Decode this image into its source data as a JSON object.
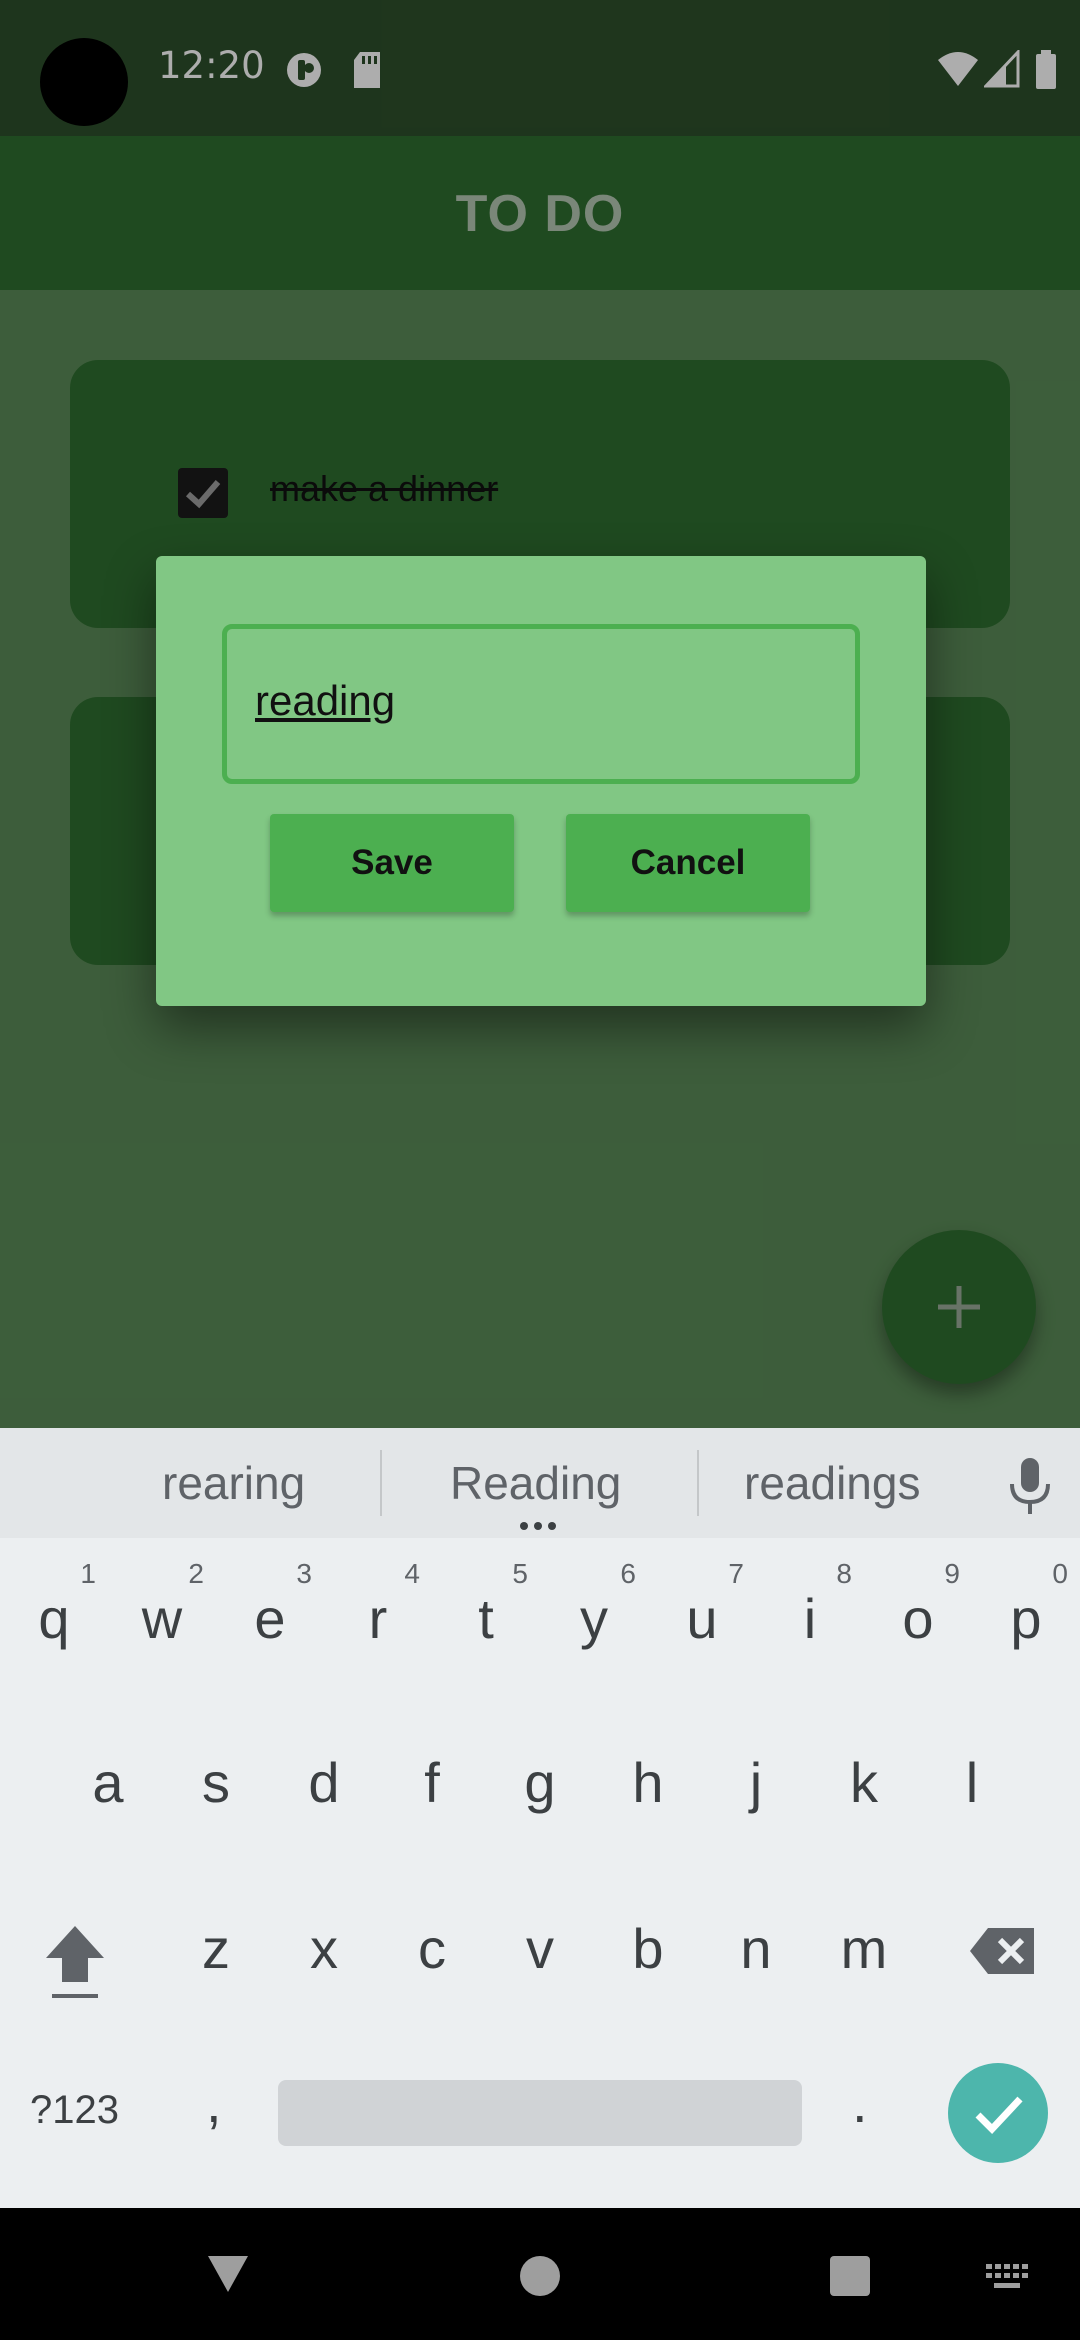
{
  "status_bar": {
    "time": "12:20"
  },
  "toolbar": {
    "title": "TO DO"
  },
  "tasks": [
    {
      "text": "make a dinner",
      "checked": true
    },
    {
      "text": "",
      "checked": false
    }
  ],
  "dialog": {
    "input_value": "reading",
    "save_label": "Save",
    "cancel_label": "Cancel"
  },
  "keyboard": {
    "suggestions": [
      "rearing",
      "Reading",
      "readings"
    ],
    "row1": [
      {
        "key": "q",
        "hint": "1"
      },
      {
        "key": "w",
        "hint": "2"
      },
      {
        "key": "e",
        "hint": "3"
      },
      {
        "key": "r",
        "hint": "4"
      },
      {
        "key": "t",
        "hint": "5"
      },
      {
        "key": "y",
        "hint": "6"
      },
      {
        "key": "u",
        "hint": "7"
      },
      {
        "key": "i",
        "hint": "8"
      },
      {
        "key": "o",
        "hint": "9"
      },
      {
        "key": "p",
        "hint": "0"
      }
    ],
    "row2": [
      "a",
      "s",
      "d",
      "f",
      "g",
      "h",
      "j",
      "k",
      "l"
    ],
    "row3": [
      "z",
      "x",
      "c",
      "v",
      "b",
      "n",
      "m"
    ],
    "symbols_label": "?123",
    "comma": ",",
    "period": "."
  },
  "colors": {
    "primary": "#2f6e30",
    "dialog_bg": "#81c784",
    "button": "#4caf50",
    "enter": "#4db6ac"
  }
}
